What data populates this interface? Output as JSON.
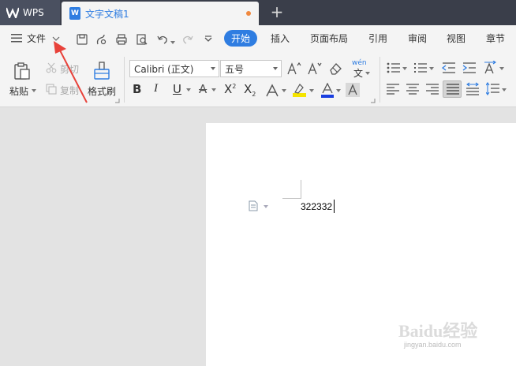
{
  "titlebar": {
    "app_tab": "WPS",
    "doc_tab": "文字文稿1",
    "doc_icon_letter": "W",
    "new_tab_symbol": "+"
  },
  "menu": {
    "file": "文件",
    "tabs": [
      "开始",
      "插入",
      "页面布局",
      "引用",
      "审阅",
      "视图",
      "章节"
    ]
  },
  "ribbon": {
    "paste": "粘贴",
    "cut": "剪切",
    "copy": "复制",
    "format_painter": "格式刷",
    "font_name": "Calibri (正文)",
    "font_size": "五号",
    "phonetic_top": "wén",
    "phonetic_char": "文"
  },
  "document": {
    "content": "322332"
  },
  "watermark": {
    "brand": "Baidu经验",
    "url": "jingyan.baidu.com"
  },
  "colors": {
    "accent": "#2f7de1",
    "annotation": "#e8423a",
    "tab_dot": "#f0883e"
  }
}
